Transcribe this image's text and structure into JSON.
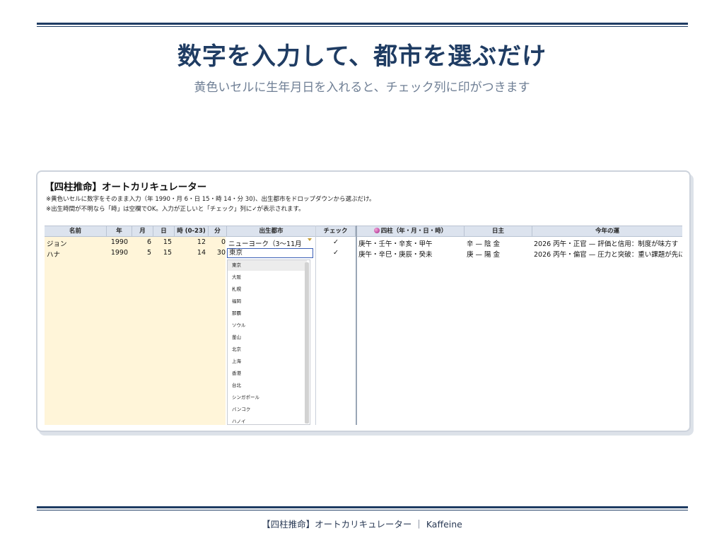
{
  "slide": {
    "title": "数字を入力して、都市を選ぶだけ",
    "subtitle": "黄色いセルに生年月日を入れると、チェック列に印がつきます",
    "footer": "【四柱推命】オートカリキュレーター ｜ Kaffeine"
  },
  "sheet": {
    "title": "【四柱推命】オートカリキュレーター",
    "notes": [
      "※黄色いセルに数字をそのまま入力（年 1990・月 6・日 15・時 14・分 30)、出生都市をドロップダウンから選ぶだけ。",
      "※出生時間が不明なら「時」は空欄でOK。入力が正しいと「チェック」列に✓が表示されます。"
    ],
    "headers": [
      "名前",
      "年",
      "月",
      "日",
      "時 (0-23)",
      "分",
      "出生都市",
      "チェック",
      "四柱（年・月・日・時）",
      "日主",
      "今年の運"
    ],
    "header_icon": "crystal-ball-icon",
    "rows": [
      {
        "name": "ジョン",
        "year": "1990",
        "month": "6",
        "day": "15",
        "hour": "12",
        "minute": "0",
        "city": "ニューヨーク（3〜11月",
        "check": "✓",
        "pillars": "庚午・壬午・辛亥・甲午",
        "day_master": "辛 — 陰 金",
        "fortune": "2026 丙午・正官 — 評価と信用：制度が味方す"
      },
      {
        "name": "ハナ",
        "year": "1990",
        "month": "5",
        "day": "15",
        "hour": "14",
        "minute": "30",
        "city": "東京",
        "check": "✓",
        "pillars": "庚午・辛巳・庚辰・癸未",
        "day_master": "庚 — 陽 金",
        "fortune": "2026 丙午・偏官 — 圧力と突破：重い課題が先に"
      }
    ],
    "dropdown": {
      "input_value": "東京",
      "options": [
        "東京",
        "大阪",
        "札幌",
        "福岡",
        "那覇",
        "ソウル",
        "釜山",
        "北京",
        "上海",
        "香港",
        "台北",
        "シンガポール",
        "バンコク",
        "ハノイ"
      ],
      "selected": "東京"
    }
  },
  "colors": {
    "navy": "#1f3c63",
    "input_yellow": "#fff5d9",
    "header_blue": "#dce3ee",
    "focus_blue": "#3b5fb6"
  }
}
